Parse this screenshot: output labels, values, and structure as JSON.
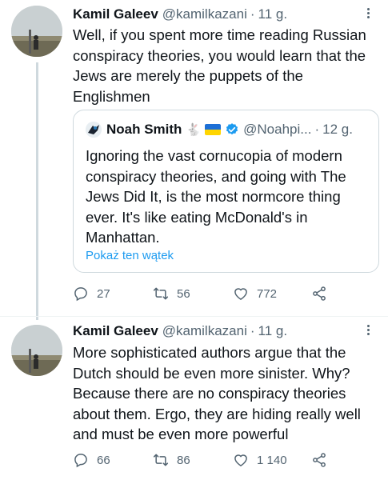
{
  "tweet1": {
    "name": "Kamil Galeev",
    "handle": "@kamilkazani",
    "dot": "·",
    "time": "11 g.",
    "text": "Well, if you spent more time reading Russian conspiracy theories, you would learn that the Jews are merely the puppets of the Englishmen",
    "quote": {
      "name": "Noah Smith",
      "emoji": "🐇",
      "handle": "@Noahpi...",
      "dot": "·",
      "time": "12 g.",
      "text": "Ignoring the vast cornucopia of modern conspiracy theories, and going with The Jews Did It, is the most normcore thing ever. It's like eating McDonald's in Manhattan.",
      "show_thread": "Pokaż ten wątek"
    },
    "replies": "27",
    "retweets": "56",
    "likes": "772"
  },
  "tweet2": {
    "name": "Kamil Galeev",
    "handle": "@kamilkazani",
    "dot": "·",
    "time": "11 g.",
    "text": "More sophisticated authors argue that the Dutch should be even more sinister. Why? Because there are no conspiracy theories about them. Ergo, they are hiding really well and must be even more powerful",
    "replies": "66",
    "retweets": "86",
    "likes": "1 140"
  },
  "colors": {
    "text": "#0f1419",
    "secondary": "#536471",
    "link": "#1d9bf0",
    "border": "#cfd9de"
  }
}
